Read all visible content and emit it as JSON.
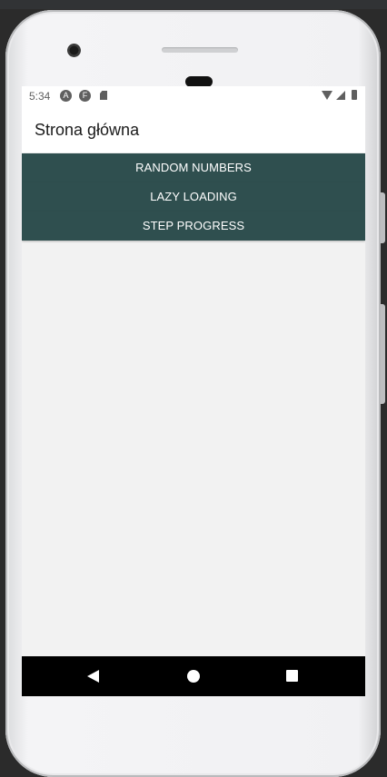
{
  "status_bar": {
    "time": "5:34",
    "left_icons": [
      "android-studio-icon",
      "flutter-icon",
      "sd-card-icon"
    ],
    "right_icons": [
      "wifi-icon",
      "signal-icon",
      "battery-icon"
    ]
  },
  "app_bar": {
    "title": "Strona główna"
  },
  "menu": {
    "buttons": [
      {
        "label": "RANDOM NUMBERS"
      },
      {
        "label": "LAZY LOADING"
      },
      {
        "label": "STEP PROGRESS"
      }
    ]
  },
  "nav_bar": {
    "icons": [
      "back-icon",
      "home-icon",
      "recent-apps-icon"
    ]
  },
  "colors": {
    "button_bg": "#2f4f4f",
    "button_text": "#ffffff",
    "screen_bg": "#f2f2f2",
    "appbar_bg": "#ffffff",
    "navbar_bg": "#000000"
  }
}
